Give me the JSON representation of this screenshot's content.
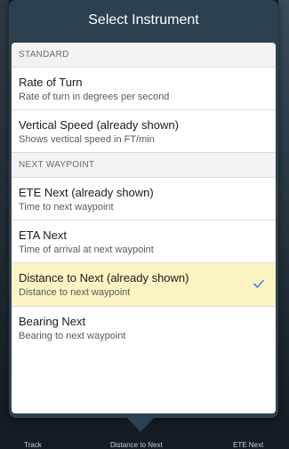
{
  "popover": {
    "title": "Select Instrument"
  },
  "sections": [
    {
      "header": "STANDARD",
      "items": [
        {
          "title": "Rate of Turn",
          "subtitle": "Rate of turn in degrees per second"
        },
        {
          "title": "Vertical Speed (already shown)",
          "subtitle": "Shows vertical speed in FT/min"
        }
      ]
    },
    {
      "header": "NEXT WAYPOINT",
      "items": [
        {
          "title": "ETE Next (already shown)",
          "subtitle": "Time to next waypoint"
        },
        {
          "title": "ETA Next",
          "subtitle": "Time of arrival at next waypoint"
        },
        {
          "title": "Distance to Next (already shown)",
          "subtitle": "Distance to next waypoint",
          "selected": true
        },
        {
          "title": "Bearing Next",
          "subtitle": "Bearing to next waypoint"
        }
      ]
    }
  ],
  "bottom_bar": {
    "labels": [
      "Track",
      "Distance to Next",
      "ETE Next"
    ]
  },
  "colors": {
    "header_bg": "#2e4150",
    "selected_row": "#fbf3c2",
    "checkmark": "#3a8ee6"
  }
}
